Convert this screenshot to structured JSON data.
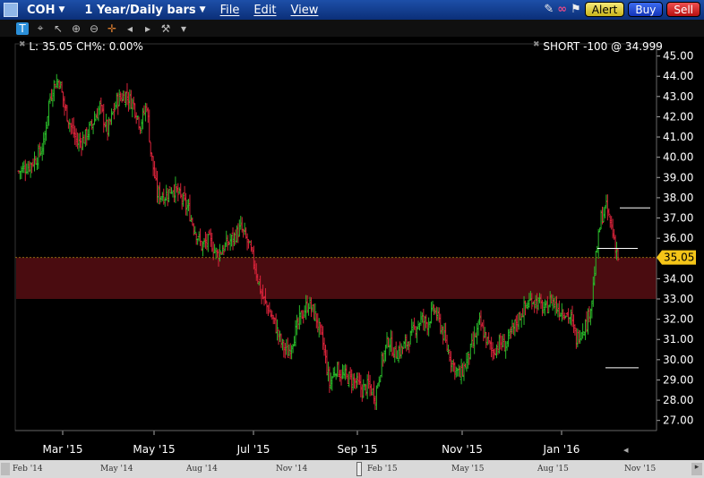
{
  "window": {
    "symbol": "COH",
    "period": "1 Year/Daily bars",
    "menus": [
      "File",
      "Edit",
      "View"
    ],
    "buttons": {
      "alert": "Alert",
      "buy": "Buy",
      "sell": "Sell"
    }
  },
  "readout": {
    "text": "L: 35.05 CH%: 0.00%"
  },
  "position": {
    "text": "SHORT -100 @ 34.999"
  },
  "price_tag": "35.05",
  "colors": {
    "up": "#29b829",
    "down": "#d8233a",
    "band": "#4a0c10",
    "accent": "#f5c518"
  },
  "scroller": {
    "labels": [
      "Feb '14",
      "May '14",
      "Aug '14",
      "Nov '14",
      "Feb '15",
      "May '15",
      "Aug '15",
      "Nov '15"
    ]
  },
  "chart_data": {
    "type": "candlestick",
    "ylim": [
      26.5,
      45.6
    ],
    "yticks": [
      "27.00",
      "28.00",
      "29.00",
      "30.00",
      "31.00",
      "32.00",
      "33.00",
      "34.00",
      "35.00",
      "36.00",
      "37.00",
      "38.00",
      "39.00",
      "40.00",
      "41.00",
      "42.00",
      "43.00",
      "44.00",
      "45.00"
    ],
    "xticks": [
      "Mar '15",
      "May '15",
      "Jul '15",
      "Sep '15",
      "Nov '15",
      "Jan '16"
    ],
    "last_price": 35.05,
    "shaded_band": [
      33.0,
      35.05
    ],
    "levels": [
      37.5,
      35.5,
      29.6
    ],
    "close_path": [
      [
        0,
        39.3
      ],
      [
        8,
        39.6
      ],
      [
        14,
        40.0
      ],
      [
        19,
        40.6
      ],
      [
        23,
        42.7
      ],
      [
        27,
        43.6
      ],
      [
        31,
        43.8
      ],
      [
        35,
        42.5
      ],
      [
        40,
        41.5
      ],
      [
        45,
        40.7
      ],
      [
        50,
        40.9
      ],
      [
        56,
        41.6
      ],
      [
        62,
        42.5
      ],
      [
        68,
        41.3
      ],
      [
        75,
        42.8
      ],
      [
        82,
        43.1
      ],
      [
        88,
        42.6
      ],
      [
        93,
        41.6
      ],
      [
        98,
        42.6
      ],
      [
        101,
        40.3
      ],
      [
        106,
        38.2
      ],
      [
        112,
        38.1
      ],
      [
        118,
        38.5
      ],
      [
        124,
        38.0
      ],
      [
        130,
        37.4
      ],
      [
        135,
        36.4
      ],
      [
        140,
        35.6
      ],
      [
        146,
        35.9
      ],
      [
        152,
        35.2
      ],
      [
        158,
        35.6
      ],
      [
        164,
        36.0
      ],
      [
        170,
        36.5
      ],
      [
        176,
        35.7
      ],
      [
        181,
        34.6
      ],
      [
        186,
        33.2
      ],
      [
        191,
        32.5
      ],
      [
        196,
        31.8
      ],
      [
        201,
        30.8
      ],
      [
        206,
        30.3
      ],
      [
        211,
        31.2
      ],
      [
        216,
        32.1
      ],
      [
        222,
        32.8
      ],
      [
        228,
        32.0
      ],
      [
        233,
        30.8
      ],
      [
        238,
        28.8
      ],
      [
        243,
        29.6
      ],
      [
        248,
        29.2
      ],
      [
        253,
        29.1
      ],
      [
        258,
        28.9
      ],
      [
        263,
        28.5
      ],
      [
        268,
        28.7
      ],
      [
        273,
        28.2
      ],
      [
        278,
        29.9
      ],
      [
        283,
        31.0
      ],
      [
        288,
        30.3
      ],
      [
        293,
        30.5
      ],
      [
        298,
        30.9
      ],
      [
        303,
        31.5
      ],
      [
        308,
        32.0
      ],
      [
        313,
        31.8
      ],
      [
        318,
        32.5
      ],
      [
        323,
        31.7
      ],
      [
        328,
        30.6
      ],
      [
        333,
        29.7
      ],
      [
        338,
        29.2
      ],
      [
        343,
        29.9
      ],
      [
        348,
        30.8
      ],
      [
        353,
        31.8
      ],
      [
        358,
        31.0
      ],
      [
        363,
        30.4
      ],
      [
        368,
        30.8
      ],
      [
        373,
        30.7
      ],
      [
        378,
        31.4
      ],
      [
        383,
        32.1
      ],
      [
        388,
        32.6
      ],
      [
        393,
        33.0
      ],
      [
        398,
        32.8
      ],
      [
        403,
        32.4
      ],
      [
        408,
        33.0
      ],
      [
        413,
        32.5
      ],
      [
        418,
        32.4
      ],
      [
        423,
        32.0
      ],
      [
        427,
        31.0
      ],
      [
        431,
        31.5
      ],
      [
        435,
        31.8
      ],
      [
        439,
        33.0
      ],
      [
        442,
        35.0
      ],
      [
        446,
        37.0
      ],
      [
        450,
        37.5
      ],
      [
        453,
        36.8
      ],
      [
        456,
        36.0
      ],
      [
        459,
        35.05
      ]
    ]
  }
}
